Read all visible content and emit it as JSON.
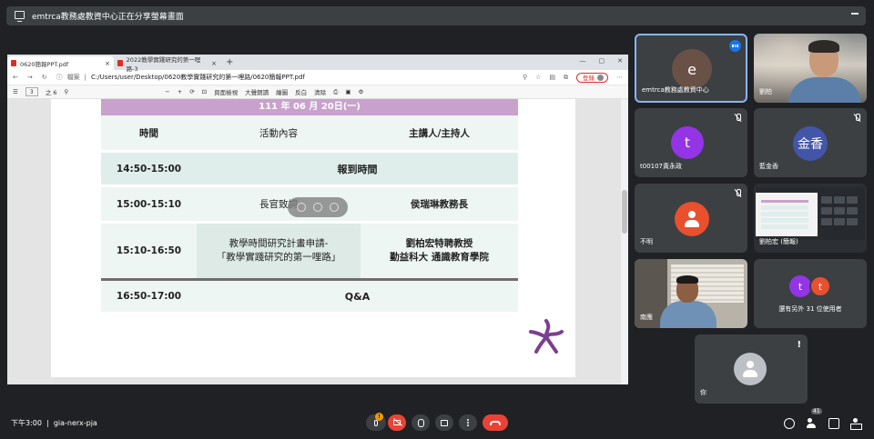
{
  "banner": {
    "text": "emtrca教務處教資中心正在分享螢幕畫面"
  },
  "browser": {
    "tabs": [
      {
        "title": "0620簡報PPT.pdf"
      },
      {
        "title": "2022教學實踐研究的第一哩路-3"
      }
    ],
    "address_prefix": "檔案",
    "url": "C:/Users/user/Desktop/0620教學實踐研究的第一哩路/0620簡報PPT.pdf",
    "login_label": "登錄",
    "page_number": "3",
    "page_total": "之 6",
    "toolbar": {
      "page_view": "頁面檢視",
      "read_aloud": "大聲朗讀",
      "draw": "繪圖",
      "highlight": "反白",
      "erase": "清除"
    }
  },
  "slide": {
    "date_header": "111 年 06 月 20日(一)",
    "columns": [
      "時間",
      "活動內容",
      "主講人/主持人"
    ],
    "rows": [
      {
        "time": "14:50-15:00",
        "activity": "報到時間",
        "speaker": ""
      },
      {
        "time": "15:00-15:10",
        "activity": "長官致詞",
        "speaker": "侯瑞琳教務長"
      },
      {
        "time": "15:10-16:50",
        "activity_line1": "教學時間研究計畫申請-",
        "activity_line2": "「教學實踐研究的第一哩路」",
        "speaker_line1": "劉柏宏特聘教授",
        "speaker_line2": "勤益科大 通識教育學院"
      },
      {
        "time": "16:50-17:00",
        "activity": "Q&A",
        "speaker": ""
      }
    ]
  },
  "participants": {
    "self": {
      "initial": "e",
      "name": "emtrca教務處教資中心"
    },
    "video1": {
      "name": "劉柏"
    },
    "tzheng": {
      "initial": "t",
      "name": "t00107黃永政"
    },
    "jinxiang": {
      "initial": "金香",
      "name": "藍金香"
    },
    "unknown": {
      "name": "不明"
    },
    "liu": {
      "name": "劉柏宏 (簡報)"
    },
    "cam2": {
      "name": "南應"
    },
    "others": {
      "initials": [
        "t",
        "t"
      ],
      "label": "還有另外 31 位使用者"
    },
    "you": {
      "name": "你"
    }
  },
  "controls": {
    "time": "下午3:00",
    "meeting_code": "gia-nerx-pja",
    "people_count": "41"
  },
  "colors": {
    "header_purple": "#c8a2cc",
    "row_green": "#eef6f4",
    "leave_red": "#ea4335",
    "speaking_blue": "#1a73e8"
  }
}
